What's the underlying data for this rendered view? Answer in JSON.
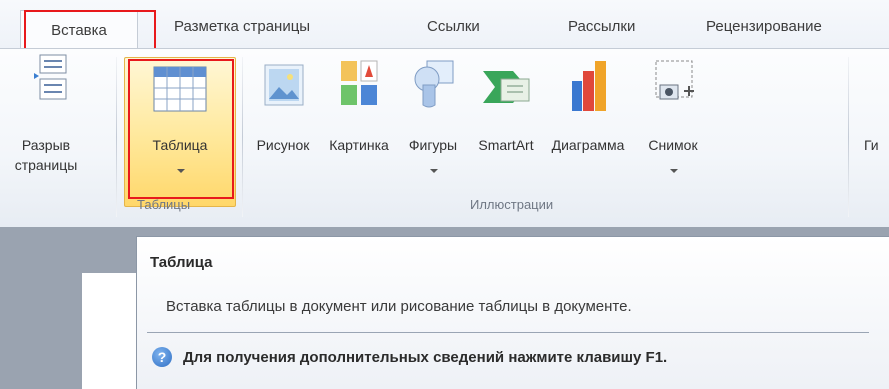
{
  "tabs": [
    {
      "label": "Вставка"
    },
    {
      "label": "Разметка страницы"
    },
    {
      "label": "Ссылки"
    },
    {
      "label": "Рассылки"
    },
    {
      "label": "Рецензирование"
    }
  ],
  "ribbon": {
    "page_break": {
      "label_line1": "Разрыв",
      "label_line2": "страницы"
    },
    "table": {
      "label": "Таблица"
    },
    "illustrations": [
      {
        "label": "Рисунок"
      },
      {
        "label": "Картинка"
      },
      {
        "label": "Фигуры"
      },
      {
        "label": "SmartArt"
      },
      {
        "label": "Диаграмма"
      },
      {
        "label": "Снимок"
      }
    ],
    "partial_next": "Ги",
    "groups": {
      "tables": "Таблицы",
      "illustrations": "Иллюстрации"
    }
  },
  "tooltip": {
    "title": "Таблица",
    "description": "Вставка таблицы в документ или рисование таблицы в документе.",
    "help_text": "Для получения дополнительных сведений нажмите клавишу F1."
  },
  "colors": {
    "highlight_box": "#e8191c",
    "selected_button": "#ffe89a",
    "help_icon": "#2f6fc4"
  }
}
